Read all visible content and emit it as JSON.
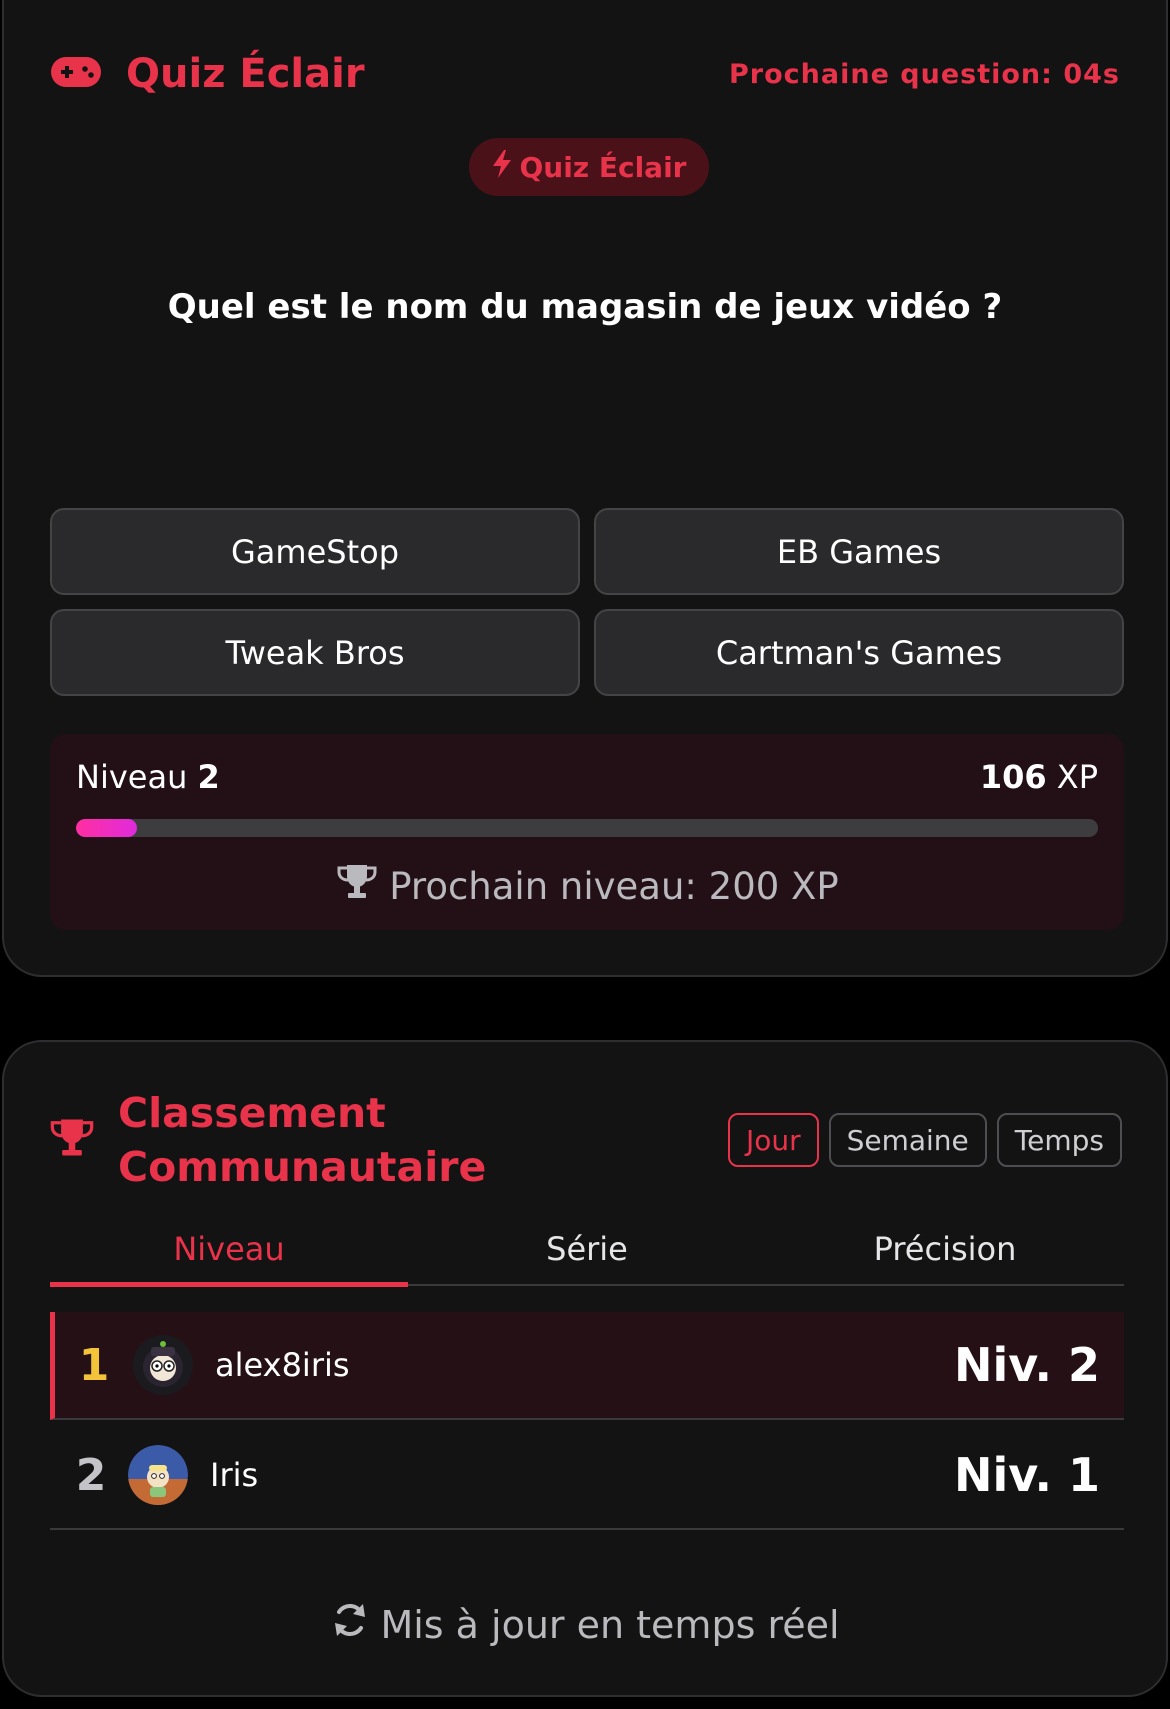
{
  "quiz": {
    "title": "Quiz Éclair",
    "countdown": "Prochaine question: 04s",
    "pill_label": "Quiz Éclair",
    "question": "Quel est le nom du magasin de jeux vidéo ?",
    "answers": [
      "GameStop",
      "EB Games",
      "Tweak Bros",
      "Cartman's Games"
    ],
    "level_label": "Niveau",
    "level_value": "2",
    "xp_value": "106",
    "xp_unit": "XP",
    "progress_fraction": 0.06,
    "next_level": "Prochain niveau: 200 XP"
  },
  "board": {
    "title": "Classement Communautaire",
    "filters": [
      "Jour",
      "Semaine",
      "Temps"
    ],
    "active_filter": "Jour",
    "tabs": [
      "Niveau",
      "Série",
      "Précision"
    ],
    "active_tab": "Niveau",
    "rows": [
      {
        "rank": "1",
        "name": "alex8iris",
        "level": "Niv. 2"
      },
      {
        "rank": "2",
        "name": "Iris",
        "level": "Niv. 1"
      }
    ],
    "footer": "Mis à jour en temps réel"
  },
  "colors": {
    "accent": "#e8334a",
    "gold": "#f3c33a",
    "progress": "#ff2fa0"
  },
  "icons": {
    "brand": "gamepad-icon",
    "pill": "lightning-icon",
    "next_level": "trophy-icon",
    "board": "trophy-icon",
    "footer": "refresh-icon"
  }
}
